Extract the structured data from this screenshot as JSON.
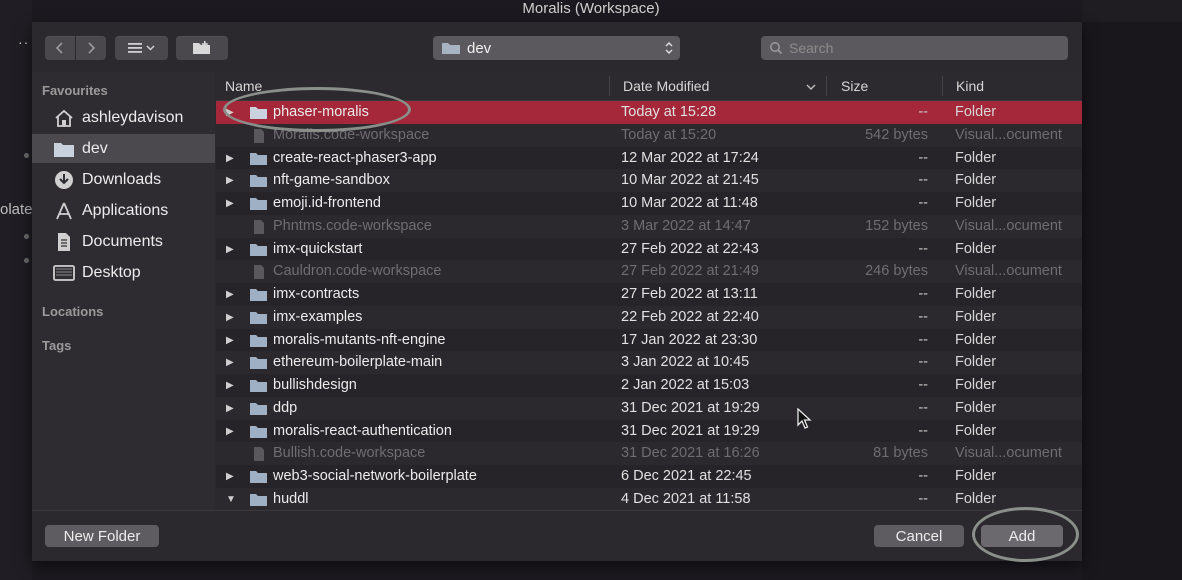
{
  "window": {
    "title": "Moralis (Workspace)"
  },
  "background": {
    "truncated_text": "olate",
    "dots": "··"
  },
  "toolbar": {
    "back_icon": "chevron-left-icon",
    "forward_icon": "chevron-right-icon",
    "view_icon": "list-view-icon",
    "new_folder_icon": "new-folder-icon",
    "path_label": "dev",
    "search_placeholder": "Search"
  },
  "sidebar": {
    "favourites_heading": "Favourites",
    "items": [
      {
        "label": "ashleydavison",
        "icon": "home-icon",
        "selected": false
      },
      {
        "label": "dev",
        "icon": "folder-icon",
        "selected": true
      },
      {
        "label": "Downloads",
        "icon": "downloads-icon",
        "selected": false
      },
      {
        "label": "Applications",
        "icon": "applications-icon",
        "selected": false
      },
      {
        "label": "Documents",
        "icon": "documents-icon",
        "selected": false
      },
      {
        "label": "Desktop",
        "icon": "desktop-icon",
        "selected": false
      }
    ],
    "locations_heading": "Locations",
    "tags_heading": "Tags"
  },
  "list": {
    "columns": {
      "name": "Name",
      "date": "Date Modified",
      "size": "Size",
      "kind": "Kind"
    },
    "rows": [
      {
        "name": "phaser-moralis",
        "date": "Today at 15:28",
        "size": "--",
        "kind": "Folder",
        "type": "folder",
        "state": "selected"
      },
      {
        "name": "Moralis.code-workspace",
        "date": "Today at 15:20",
        "size": "542 bytes",
        "kind": "Visual...ocument",
        "type": "file",
        "state": "dim"
      },
      {
        "name": "create-react-phaser3-app",
        "date": "12 Mar 2022 at 17:24",
        "size": "--",
        "kind": "Folder",
        "type": "folder",
        "state": ""
      },
      {
        "name": "nft-game-sandbox",
        "date": "10 Mar 2022 at 21:45",
        "size": "--",
        "kind": "Folder",
        "type": "folder",
        "state": ""
      },
      {
        "name": "emoji.id-frontend",
        "date": "10 Mar 2022 at 11:48",
        "size": "--",
        "kind": "Folder",
        "type": "folder",
        "state": ""
      },
      {
        "name": "Phntms.code-workspace",
        "date": "3 Mar 2022 at 14:47",
        "size": "152 bytes",
        "kind": "Visual...ocument",
        "type": "file",
        "state": "dim"
      },
      {
        "name": "imx-quickstart",
        "date": "27 Feb 2022 at 22:43",
        "size": "--",
        "kind": "Folder",
        "type": "folder",
        "state": ""
      },
      {
        "name": "Cauldron.code-workspace",
        "date": "27 Feb 2022 at 21:49",
        "size": "246 bytes",
        "kind": "Visual...ocument",
        "type": "file",
        "state": "dim"
      },
      {
        "name": "imx-contracts",
        "date": "27 Feb 2022 at 13:11",
        "size": "--",
        "kind": "Folder",
        "type": "folder",
        "state": ""
      },
      {
        "name": "imx-examples",
        "date": "22 Feb 2022 at 22:40",
        "size": "--",
        "kind": "Folder",
        "type": "folder",
        "state": ""
      },
      {
        "name": "moralis-mutants-nft-engine",
        "date": "17 Jan 2022 at 23:30",
        "size": "--",
        "kind": "Folder",
        "type": "folder",
        "state": ""
      },
      {
        "name": "ethereum-boilerplate-main",
        "date": "3 Jan 2022 at 10:45",
        "size": "--",
        "kind": "Folder",
        "type": "folder",
        "state": ""
      },
      {
        "name": "bullishdesign",
        "date": "2 Jan 2022 at 15:03",
        "size": "--",
        "kind": "Folder",
        "type": "folder",
        "state": ""
      },
      {
        "name": "ddp",
        "date": "31 Dec 2021 at 19:29",
        "size": "--",
        "kind": "Folder",
        "type": "folder",
        "state": ""
      },
      {
        "name": "moralis-react-authentication",
        "date": "31 Dec 2021 at 19:29",
        "size": "--",
        "kind": "Folder",
        "type": "folder",
        "state": ""
      },
      {
        "name": "Bullish.code-workspace",
        "date": "31 Dec 2021 at 16:26",
        "size": "81 bytes",
        "kind": "Visual...ocument",
        "type": "file",
        "state": "dim"
      },
      {
        "name": "web3-social-network-boilerplate",
        "date": "6 Dec 2021 at 22:45",
        "size": "--",
        "kind": "Folder",
        "type": "folder",
        "state": ""
      },
      {
        "name": "huddl",
        "date": "4 Dec 2021 at 11:58",
        "size": "--",
        "kind": "Folder",
        "type": "folder",
        "state": "expanded"
      }
    ]
  },
  "footer": {
    "new_folder_label": "New Folder",
    "cancel_label": "Cancel",
    "add_label": "Add"
  },
  "colors": {
    "selection": "#a5273a",
    "dialog": "#2b292d",
    "annotation_ring": "#8a8f8a"
  }
}
